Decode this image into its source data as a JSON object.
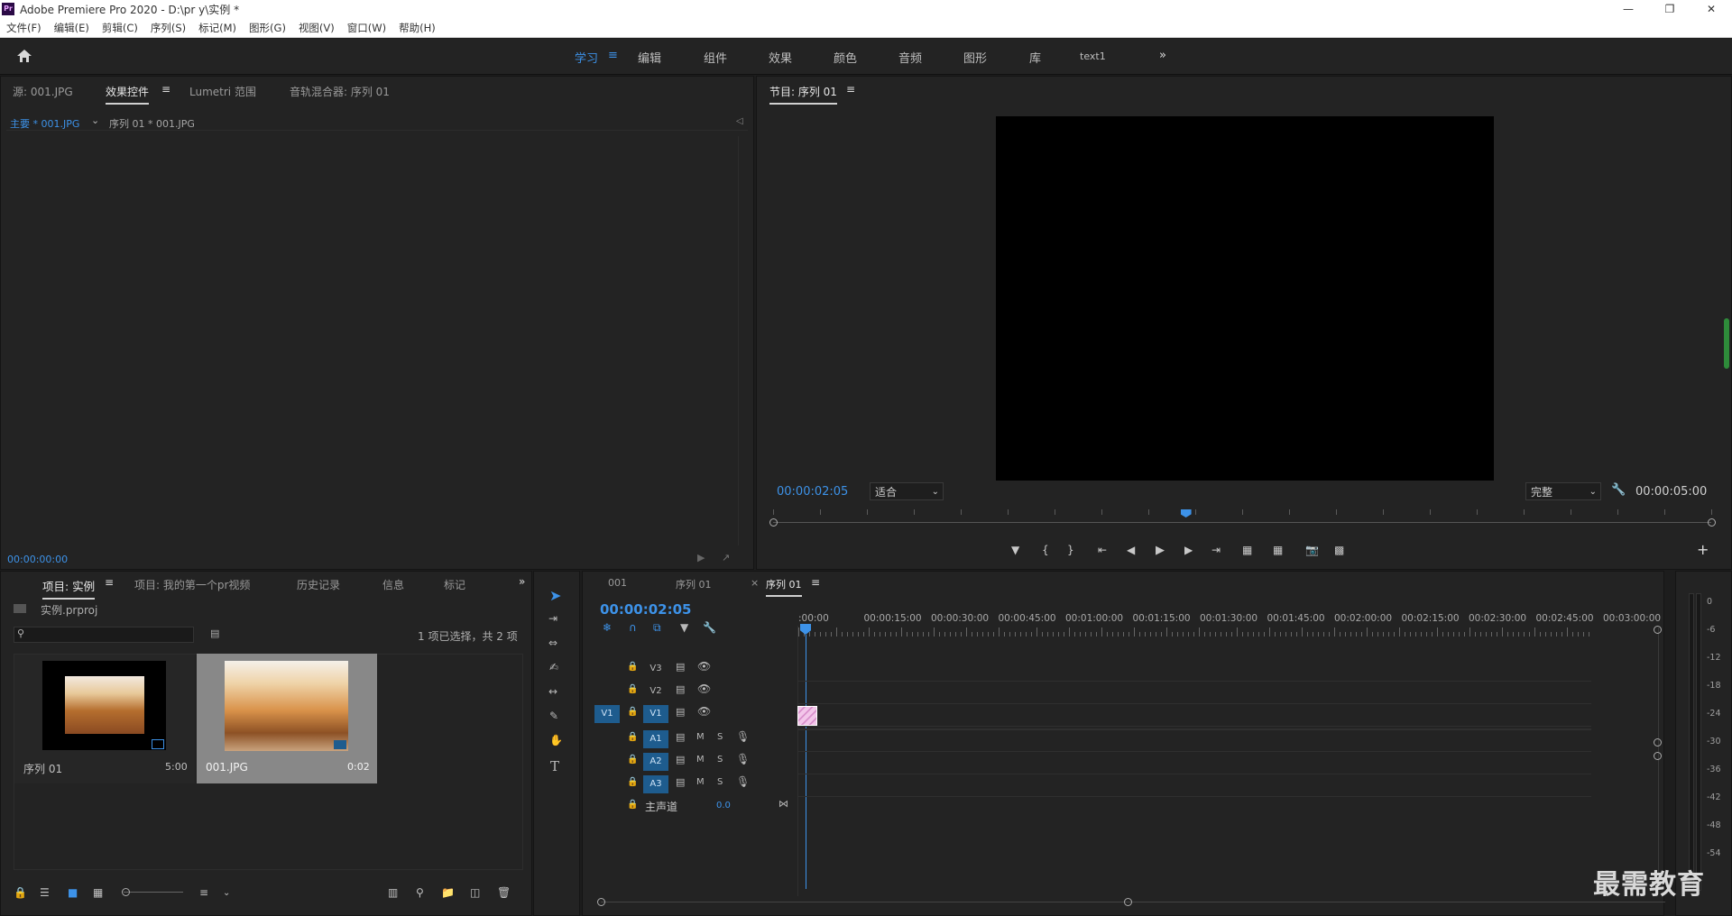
{
  "app": {
    "title": "Adobe Premiere Pro 2020 - D:\\pr y\\实例 *",
    "logo": "Pr"
  },
  "menu": [
    "文件(F)",
    "编辑(E)",
    "剪辑(C)",
    "序列(S)",
    "标记(M)",
    "图形(G)",
    "视图(V)",
    "窗口(W)",
    "帮助(H)"
  ],
  "workspace": {
    "tabs": [
      "学习",
      "编辑",
      "组件",
      "效果",
      "颜色",
      "音频",
      "图形",
      "库",
      "text1"
    ],
    "active": "学习"
  },
  "source_panel": {
    "tabs": [
      "源: 001.JPG",
      "效果控件",
      "Lumetri 范围",
      "音轨混合器: 序列 01"
    ],
    "active": "效果控件",
    "master_clip": "主要 * 001.JPG",
    "sequence_clip": "序列 01 * 001.JPG",
    "timecode": "00:00:00:00"
  },
  "program_monitor": {
    "title": "节目: 序列 01",
    "timecode": "00:00:02:05",
    "fit": "适合",
    "quality": "完整",
    "duration": "00:00:05:00",
    "playhead_fraction": 0.44
  },
  "project_panel": {
    "tabs": [
      "项目: 实例",
      "项目: 我的第一个pr视频",
      "历史记录",
      "信息",
      "标记"
    ],
    "active": "项目: 实例",
    "project_file": "实例.prproj",
    "selection_info": "1 项已选择，共 2 项",
    "items": [
      {
        "name": "序列 01",
        "duration": "5:00",
        "selected": false
      },
      {
        "name": "001.JPG",
        "duration": "0:02",
        "selected": true
      }
    ]
  },
  "timeline": {
    "tabs": [
      "001",
      "序列 01",
      "序列 01"
    ],
    "active_index": 2,
    "timecode": "00:00:02:05",
    "ruler": [
      ":00:00",
      "00:00:15:00",
      "00:00:30:00",
      "00:00:45:00",
      "00:01:00:00",
      "00:01:15:00",
      "00:01:30:00",
      "00:01:45:00",
      "00:02:00:00",
      "00:02:15:00",
      "00:02:30:00",
      "00:02:45:00",
      "00:03:00:00"
    ],
    "video_tracks": [
      "V3",
      "V2",
      "V1"
    ],
    "source_patch": "V1",
    "audio_tracks": [
      "A1",
      "A2",
      "A3"
    ],
    "mute_label": "M",
    "solo_label": "S",
    "master": {
      "label": "主声道",
      "value": "0.0"
    }
  },
  "audio_meter": {
    "levels": [
      "0",
      "-6",
      "-12",
      "-18",
      "-24",
      "-30",
      "-36",
      "-42",
      "-48",
      "-54"
    ],
    "unit": "dB"
  },
  "watermark": "最需教育",
  "colors": {
    "accent": "#3d92e8",
    "panel": "#232323",
    "track_on": "#1e5c8e",
    "clip": "#e6a4d8"
  }
}
